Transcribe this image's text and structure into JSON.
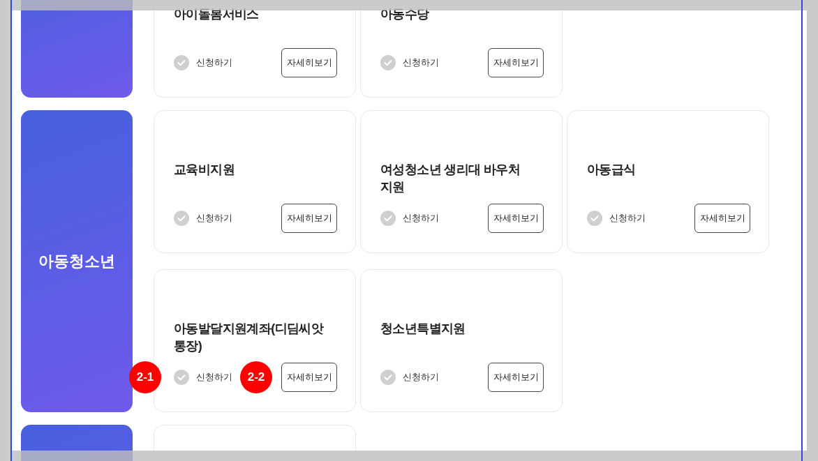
{
  "groups": [
    {
      "cards": [
        {
          "kind": "service",
          "title": "아이돌봄서비스",
          "apply": "신청하기",
          "detail": "자세히보기"
        },
        {
          "kind": "service",
          "title": "아동수당",
          "apply": "신청하기",
          "detail": "자세히보기"
        }
      ]
    },
    {
      "category": "아동청소년",
      "cards": [
        {
          "kind": "service",
          "title": "교육비지원",
          "apply": "신청하기",
          "detail": "자세히보기"
        },
        {
          "kind": "service",
          "title": "여성청소년 생리대 바우처\n지원",
          "apply": "신청하기",
          "detail": "자세히보기"
        },
        {
          "kind": "service",
          "title": "아동급식",
          "apply": "신청하기",
          "detail": "자세히보기"
        },
        {
          "kind": "service",
          "title": "아동발달지원계좌(디딤씨앗\n통장)",
          "apply": "신청하기",
          "detail": "자세히보기",
          "badges": [
            {
              "label": "2-1",
              "kind": "apply"
            },
            {
              "label": "2-2",
              "kind": "detail"
            }
          ]
        },
        {
          "kind": "service",
          "title": "청소년특별지원",
          "apply": "신청하기",
          "detail": "자세히보기"
        }
      ]
    },
    {
      "cards": [
        {
          "kind": "blank"
        }
      ]
    }
  ]
}
